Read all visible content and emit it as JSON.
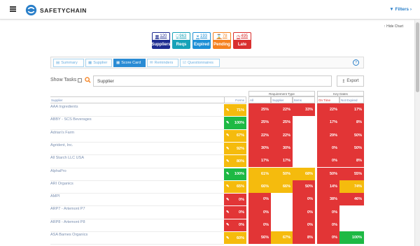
{
  "app": {
    "brand": "SAFETYCHAIN",
    "filters_label": "Filters",
    "hide_chart": "Hide Chart"
  },
  "badges": [
    {
      "count": "120",
      "label": "Suppliers",
      "icon": "card-icon"
    },
    {
      "count": "963",
      "label": "Reqs",
      "icon": "doc-icon"
    },
    {
      "count": "193",
      "label": "Expired",
      "icon": "x-icon"
    },
    {
      "count": "78",
      "label": "Pending",
      "icon": "hourglass-icon"
    },
    {
      "count": "495",
      "label": "Late",
      "icon": "clock-icon"
    }
  ],
  "tabs": [
    {
      "label": "Summary"
    },
    {
      "label": "Supplier"
    },
    {
      "label": "Score Card"
    },
    {
      "label": "Reminders"
    },
    {
      "label": "Questionnaires"
    }
  ],
  "controls": {
    "show_tasks": "Show Tasks",
    "search_value": "Supplier",
    "export": "Export",
    "help": "?"
  },
  "table": {
    "col_supplier": "Supplier",
    "col_forms": "Forms",
    "group_req": "Requirement Type",
    "group_key": "Key Dates",
    "sub_all": "All",
    "sub_supplier": "Supplier",
    "sub_items": "Items",
    "sub_ontime": "On Time",
    "sub_notexpired": "Not Expired",
    "rows": [
      {
        "name": "AAA Ingredients",
        "forms": "71%",
        "fc": "yellow",
        "all": "25%",
        "allc": "red",
        "sup": "22%",
        "supc": "red",
        "items": "33%",
        "itemsc": "red",
        "ont": "22%",
        "ontc": "red",
        "nexp": "17%",
        "nexpc": "red"
      },
      {
        "name": "ABBY - SCS Beverages",
        "forms": "100%",
        "fc": "green",
        "all": "25%",
        "allc": "red",
        "sup": "25%",
        "supc": "red",
        "items": "",
        "itemsc": "white",
        "ont": "17%",
        "ontc": "red",
        "nexp": "8%",
        "nexpc": "red"
      },
      {
        "name": "Adrian's Farm",
        "forms": "67%",
        "fc": "yellow",
        "all": "22%",
        "allc": "red",
        "sup": "22%",
        "supc": "red",
        "items": "",
        "itemsc": "white",
        "ont": "29%",
        "ontc": "red",
        "nexp": "50%",
        "nexpc": "red"
      },
      {
        "name": "Agrident, Inc.",
        "forms": "92%",
        "fc": "yellow",
        "all": "30%",
        "allc": "red",
        "sup": "30%",
        "supc": "red",
        "items": "",
        "itemsc": "white",
        "ont": "0%",
        "ontc": "red",
        "nexp": "50%",
        "nexpc": "red"
      },
      {
        "name": "All Starch LLC USA",
        "forms": "80%",
        "fc": "yellow",
        "all": "17%",
        "allc": "red",
        "sup": "17%",
        "supc": "red",
        "items": "",
        "itemsc": "white",
        "ont": "0%",
        "ontc": "red",
        "nexp": "8%",
        "nexpc": "red"
      },
      {
        "name": "AlphaPro",
        "forms": "100%",
        "fc": "green",
        "all": "61%",
        "allc": "yellow",
        "sup": "50%",
        "supc": "yellow",
        "items": "68%",
        "itemsc": "yellow",
        "ont": "50%",
        "ontc": "red",
        "nexp": "55%",
        "nexpc": "red"
      },
      {
        "name": "ARI Organics",
        "forms": "65%",
        "fc": "yellow",
        "all": "66%",
        "allc": "yellow",
        "sup": "66%",
        "supc": "yellow",
        "items": "50%",
        "itemsc": "red",
        "ont": "14%",
        "ontc": "red",
        "nexp": "74%",
        "nexpc": "yellow"
      },
      {
        "name": "AMPI",
        "forms": "0%",
        "fc": "red",
        "all": "0%",
        "allc": "red",
        "sup": "",
        "supc": "white",
        "items": "0%",
        "itemsc": "red",
        "ont": "38%",
        "ontc": "red",
        "nexp": "46%",
        "nexpc": "red"
      },
      {
        "name": "ARP7 - Artemont P7",
        "forms": "0%",
        "fc": "red",
        "all": "0%",
        "allc": "red",
        "sup": "",
        "supc": "white",
        "items": "0%",
        "itemsc": "red",
        "ont": "0%",
        "ontc": "red",
        "nexp": "",
        "nexpc": "white"
      },
      {
        "name": "ARP8 - Artemont P8",
        "forms": "0%",
        "fc": "red",
        "all": "0%",
        "allc": "red",
        "sup": "",
        "supc": "white",
        "items": "0%",
        "itemsc": "red",
        "ont": "0%",
        "ontc": "red",
        "nexp": "",
        "nexpc": "white"
      },
      {
        "name": "ASA Barnes Organics",
        "forms": "60%",
        "fc": "yellow",
        "all": "56%",
        "allc": "red",
        "sup": "67%",
        "supc": "yellow",
        "items": "8%",
        "itemsc": "red",
        "ont": "0%",
        "ontc": "red",
        "nexp": "100%",
        "nexpc": "green"
      }
    ]
  }
}
